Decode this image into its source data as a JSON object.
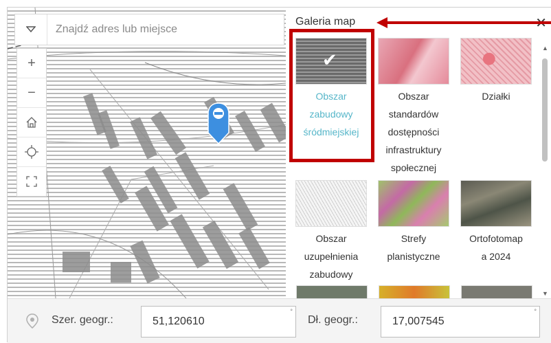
{
  "search": {
    "placeholder": "Znajdź adres lub miejsce"
  },
  "panel": {
    "title": "Galeria map",
    "items": [
      {
        "label_lines": [
          "Obszar",
          "zabudowy",
          "śródmiejskiej"
        ],
        "selected": true
      },
      {
        "label_lines": [
          "Obszar",
          "standardów",
          "dostępności",
          "infrastruktury",
          "społecznej"
        ],
        "selected": false
      },
      {
        "label_lines": [
          "Działki"
        ],
        "selected": false
      },
      {
        "label_lines": [
          "Obszar",
          "uzupełnienia",
          "zabudowy"
        ],
        "selected": false
      },
      {
        "label_lines": [
          "Strefy",
          "planistyczne"
        ],
        "selected": false
      },
      {
        "label_lines": [
          "Ortofotomap",
          "a 2024"
        ],
        "selected": false
      }
    ]
  },
  "coords": {
    "lat_label": "Szer. geogr.:",
    "lat_value": "51,120610",
    "lon_label": "Dł. geogr.:",
    "lon_value": "17,007545"
  },
  "colors": {
    "accent": "#56b6c9",
    "marker": "#3d8fe0",
    "annotation": "#c00000"
  }
}
